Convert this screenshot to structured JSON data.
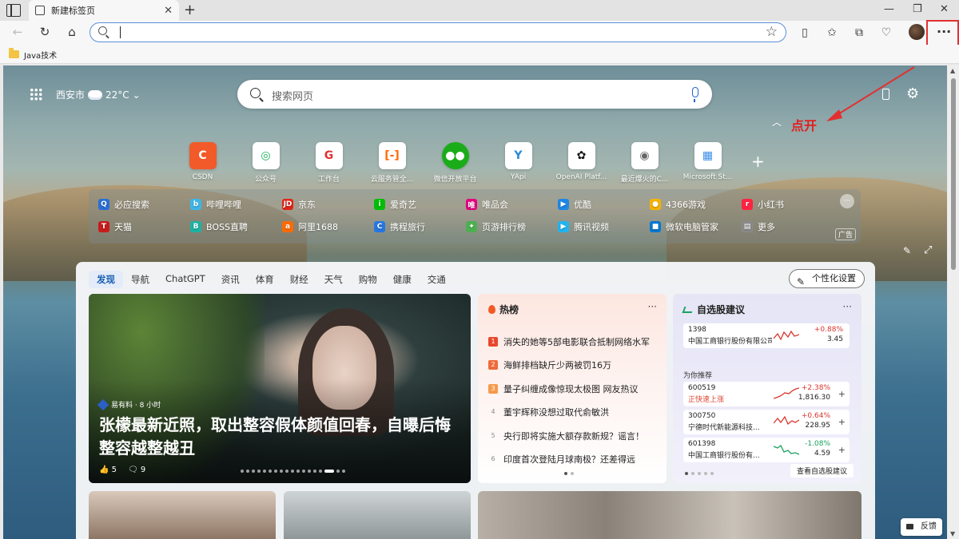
{
  "browser": {
    "tab_title": "新建标签页",
    "bookmark": "Java技术"
  },
  "newtab": {
    "city": "西安市",
    "temperature": "22°C",
    "search_placeholder": "搜索网页",
    "annotation": "点开",
    "tiles": [
      "CSDN",
      "公众号",
      "工作台",
      "云服务管全...",
      "微信开放平台",
      "YApi",
      "OpenAI Platf...",
      "最近爆火的C...",
      "Microsoft St..."
    ],
    "quicklinks_row1": [
      "必应搜索",
      "哔哩哔哩",
      "京东",
      "爱奇艺",
      "唯品会",
      "优酷",
      "4366游戏",
      "小红书"
    ],
    "quicklinks_row2": [
      "天猫",
      "BOSS直聘",
      "阿里1688",
      "携程旅行",
      "页游排行榜",
      "腾讯视频",
      "微软电脑管家",
      "更多"
    ],
    "ad_label": "广告"
  },
  "feed": {
    "tabs": [
      "发现",
      "导航",
      "ChatGPT",
      "资讯",
      "体育",
      "财经",
      "天气",
      "购物",
      "健康",
      "交通"
    ],
    "personalize": "个性化设置",
    "hero": {
      "source": "易有料 · 8 小时",
      "title": "张檬最新近照，取出整容假体颜值回春，自曝后悔整容越整越丑",
      "likes": "5",
      "comments": "9"
    },
    "hot": {
      "title": "热榜",
      "more": "···",
      "items": [
        {
          "rank": "1",
          "text": "消失的她等5部电影联合抵制网络水军"
        },
        {
          "rank": "2",
          "text": "海鲜排档缺斤少两被罚16万"
        },
        {
          "rank": "3",
          "text": "量子纠缠成像惊现太极图 网友热议"
        },
        {
          "rank": "4",
          "text": "董宇辉称没想过取代俞敏洪"
        },
        {
          "rank": "5",
          "text": "央行即将实施大额存款新规？谣言！"
        },
        {
          "rank": "6",
          "text": "印度首次登陆月球南极？还差得远"
        }
      ]
    },
    "stocks": {
      "title": "自选股建议",
      "more": "···",
      "recommend_label": "为你推荐",
      "view_all": "查看自选股建议",
      "watch": {
        "code": "1398",
        "name": "中国工商银行股份有限公司",
        "change": "+0.88%",
        "price": "3.45"
      },
      "recommend": [
        {
          "code": "600519",
          "name": "正快速上涨",
          "change": "+2.38%",
          "price": "1,816.30"
        },
        {
          "code": "300750",
          "name": "宁德时代新能源科技...",
          "change": "+0.64%",
          "price": "228.95"
        },
        {
          "code": "601398",
          "name": "中国工商银行股份有...",
          "change": "-1.08%",
          "price": "4.59"
        }
      ]
    }
  },
  "feedback": "反馈",
  "colors": {
    "accent": "#1a5fb4",
    "annotation_red": "#e23030",
    "stock_up": "#d9352c",
    "stock_down": "#1aa260"
  }
}
